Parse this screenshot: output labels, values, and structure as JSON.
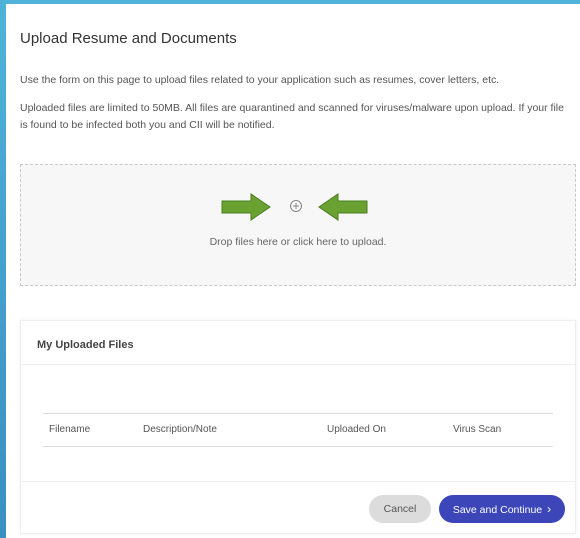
{
  "page": {
    "title": "Upload Resume and Documents",
    "intro": "Use the form on this page to upload files related to your application such as resumes, cover letters, etc.",
    "limits": "Uploaded files are limited to 50MB. All files are quarantined and scanned for viruses/malware upon upload. If your file is found to be infected both you and CII will be notified."
  },
  "dropzone": {
    "text": "Drop files here or click here to upload.",
    "icon": "plus-circle-icon",
    "arrow_color": "#6aa232"
  },
  "files": {
    "title": "My Uploaded Files",
    "columns": [
      "Filename",
      "Description/Note",
      "Uploaded On",
      "Virus Scan"
    ]
  },
  "footer": {
    "cancel_label": "Cancel",
    "save_label": "Save and Continue",
    "save_icon": "chevron-right-icon"
  },
  "colors": {
    "background": "#4fb3d9",
    "primary_button": "#3c46b8",
    "secondary_button": "#dcdcdc"
  }
}
